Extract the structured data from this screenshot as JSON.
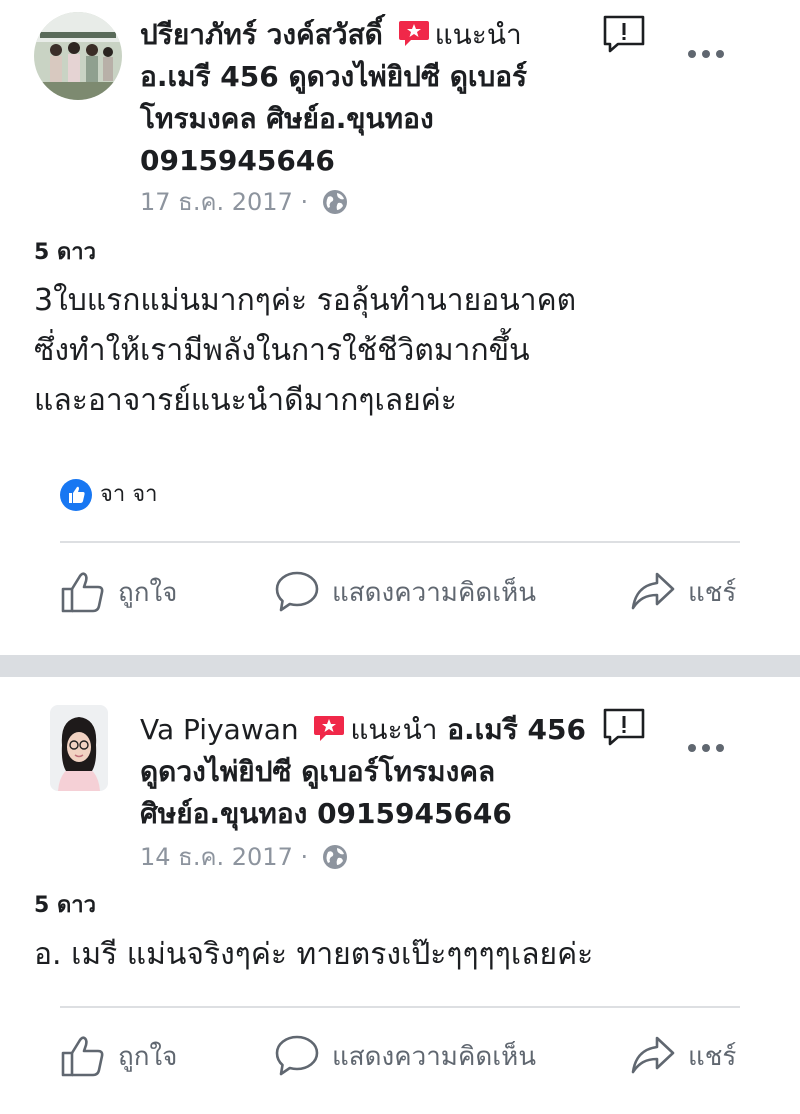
{
  "posts": [
    {
      "author": "ปรียาภัทร์ วงค์สวัสดิ์",
      "recommend_label": "แนะนำ",
      "header_text": [
        "อ.เมรี 456 ดูดวงไพ่ยิปซี ดูเบอร์",
        "โทรมงคล ศิษย์อ.ขุนทอง",
        "0915945646"
      ],
      "date": "17 ธ.ค. 2017 ·",
      "rating": "5 ดาว",
      "body": [
        "3ใบแรกแม่นมากๆค่ะ รอลุ้นทำนายอนาคต",
        "ซึ่งทำให้เรามีพลังในการใช้ชีวิตมากขึ้น",
        "และอาจารย์แนะนำดีมากๆเลยค่ะ"
      ],
      "reactor": "จา จา"
    },
    {
      "author": "Va Piyawan",
      "recommend_label": "แนะนำ",
      "header_inline": "อ.เมรี 456",
      "header_text": [
        "ดูดวงไพ่ยิปซี ดูเบอร์โทรมงคล",
        "ศิษย์อ.ขุนทอง 0915945646"
      ],
      "date": "14 ธ.ค. 2017 ·",
      "rating": "5 ดาว",
      "body": [
        "อ. เมรี แม่นจริงๆค่ะ ทายตรงเป๊ะๆๆๆๆเลยค่ะ"
      ]
    }
  ],
  "actions": {
    "like": "ถูกใจ",
    "comment": "แสดงความคิดเห็น",
    "share": "แชร์"
  },
  "colors": {
    "accent_blue": "#1877f2",
    "badge_red": "#f02849",
    "muted_text": "#8d949e",
    "action_text": "#606770",
    "separator": "#dadde1"
  },
  "icons": [
    "globe-icon",
    "report-icon",
    "more-icon",
    "like-icon",
    "comment-icon",
    "share-icon",
    "recommend-badge-icon"
  ]
}
